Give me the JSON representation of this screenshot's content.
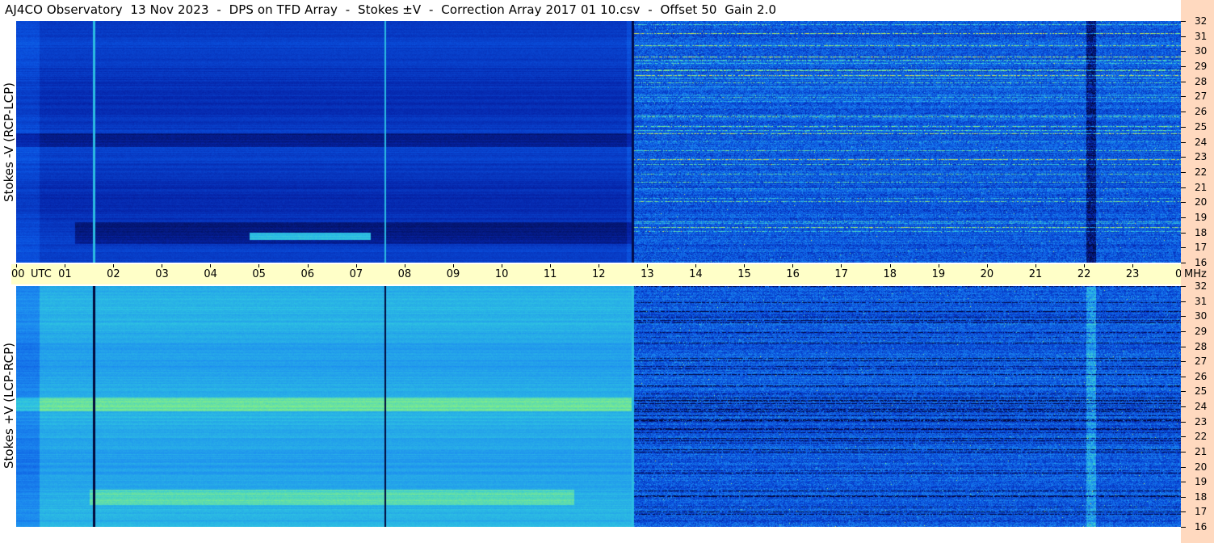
{
  "title": "AJ4CO Observatory  13 Nov 2023  -  DPS on TFD Array  -  Stokes ±V  -  Correction Array 2017 01 10.csv  -  Offset 50  Gain 2.0",
  "colors": {
    "time_axis_bg": "#ffffc8",
    "freq_axis_bg": "#ffd9bf",
    "colormap": [
      "#02083a",
      "#0523a8",
      "#0a52e0",
      "#1d8df0",
      "#2fc6e0",
      "#8ef27a",
      "#f6e23a",
      "#f07a2a"
    ]
  },
  "chart_data": {
    "type": "heatmap",
    "title": "AJ4CO Observatory  13 Nov 2023  -  DPS on TFD Array  -  Stokes ±V  -  Correction Array 2017 01 10.csv  -  Offset 50  Gain 2.0",
    "x_unit": "UTC",
    "y_unit": "MHz",
    "x_ticks": [
      "00",
      "01",
      "02",
      "03",
      "04",
      "05",
      "06",
      "07",
      "08",
      "09",
      "10",
      "11",
      "12",
      "13",
      "14",
      "15",
      "16",
      "17",
      "18",
      "19",
      "20",
      "21",
      "22",
      "23",
      "00"
    ],
    "x_range_hours": [
      0,
      24
    ],
    "y_ticks": [
      "32",
      "31",
      "30",
      "29",
      "28",
      "27",
      "26",
      "25",
      "24",
      "23",
      "22",
      "21",
      "20",
      "19",
      "18",
      "17",
      "16"
    ],
    "y_range_mhz": [
      16,
      32
    ],
    "panels": [
      {
        "name": "top",
        "ylabel": "Stokes -V (RCP-LCP)",
        "features": {
          "quiet_period_hours": [
            0,
            12.7
          ],
          "transition_hour": 12.7,
          "vertical_marker_hours": [
            1.6,
            7.6
          ],
          "dark_gap_hours": [
            22.05,
            22.25
          ],
          "dark_band_mhz": [
            23.7,
            24.6
          ],
          "strong_band_mhz": [
            17.5,
            18.0
          ],
          "strong_band_hours": [
            4.8,
            7.3
          ]
        }
      },
      {
        "name": "bottom",
        "ylabel": "Stokes +V (LCP-RCP)",
        "features": {
          "quiet_period_hours": [
            0,
            12.7
          ],
          "transition_hour": 12.7,
          "vertical_marker_hours": [
            1.6,
            7.6
          ],
          "bright_gap_hours": [
            22.05,
            22.25
          ],
          "bright_band_mhz": [
            23.7,
            24.6
          ],
          "strong_band_mhz": [
            17.5,
            18.5
          ],
          "strong_band_hours": [
            1.5,
            11.5
          ]
        }
      }
    ]
  }
}
